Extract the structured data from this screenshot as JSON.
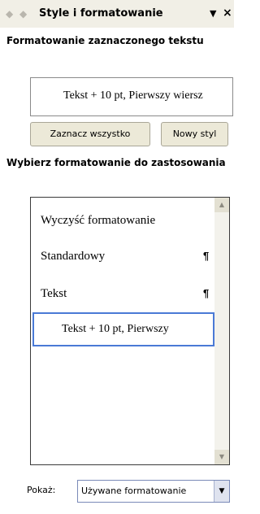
{
  "panel": {
    "title": "Style i formatowanie",
    "back_icon": "◆",
    "forward_icon": "◆",
    "dropdown_icon": "▼",
    "close_icon": "×"
  },
  "current": {
    "label": "Formatowanie zaznaczonego tekstu",
    "value": "Tekst + 10 pt, Pierwszy wiersz"
  },
  "buttons": {
    "select_all": "Zaznacz wszystko",
    "new_style": "Nowy styl"
  },
  "apply": {
    "label": "Wybierz formatowanie do zastosowania",
    "items": [
      {
        "label": "Wyczyść formatowanie",
        "mark": ""
      },
      {
        "label": "Standardowy",
        "mark": "¶"
      },
      {
        "label": "Tekst",
        "mark": "¶"
      },
      {
        "label": "Tekst + 10 pt, Pierwszy",
        "mark": ""
      }
    ],
    "scroll_up_icon": "▲",
    "scroll_down_icon": "▼"
  },
  "show": {
    "label": "Pokaż:",
    "value": "Używane formatowanie",
    "arrow_icon": "▼"
  },
  "colors": {
    "titlebar": "#f1efe6",
    "selection_border": "#4a7ad6",
    "button_face": "#ece9d8"
  }
}
